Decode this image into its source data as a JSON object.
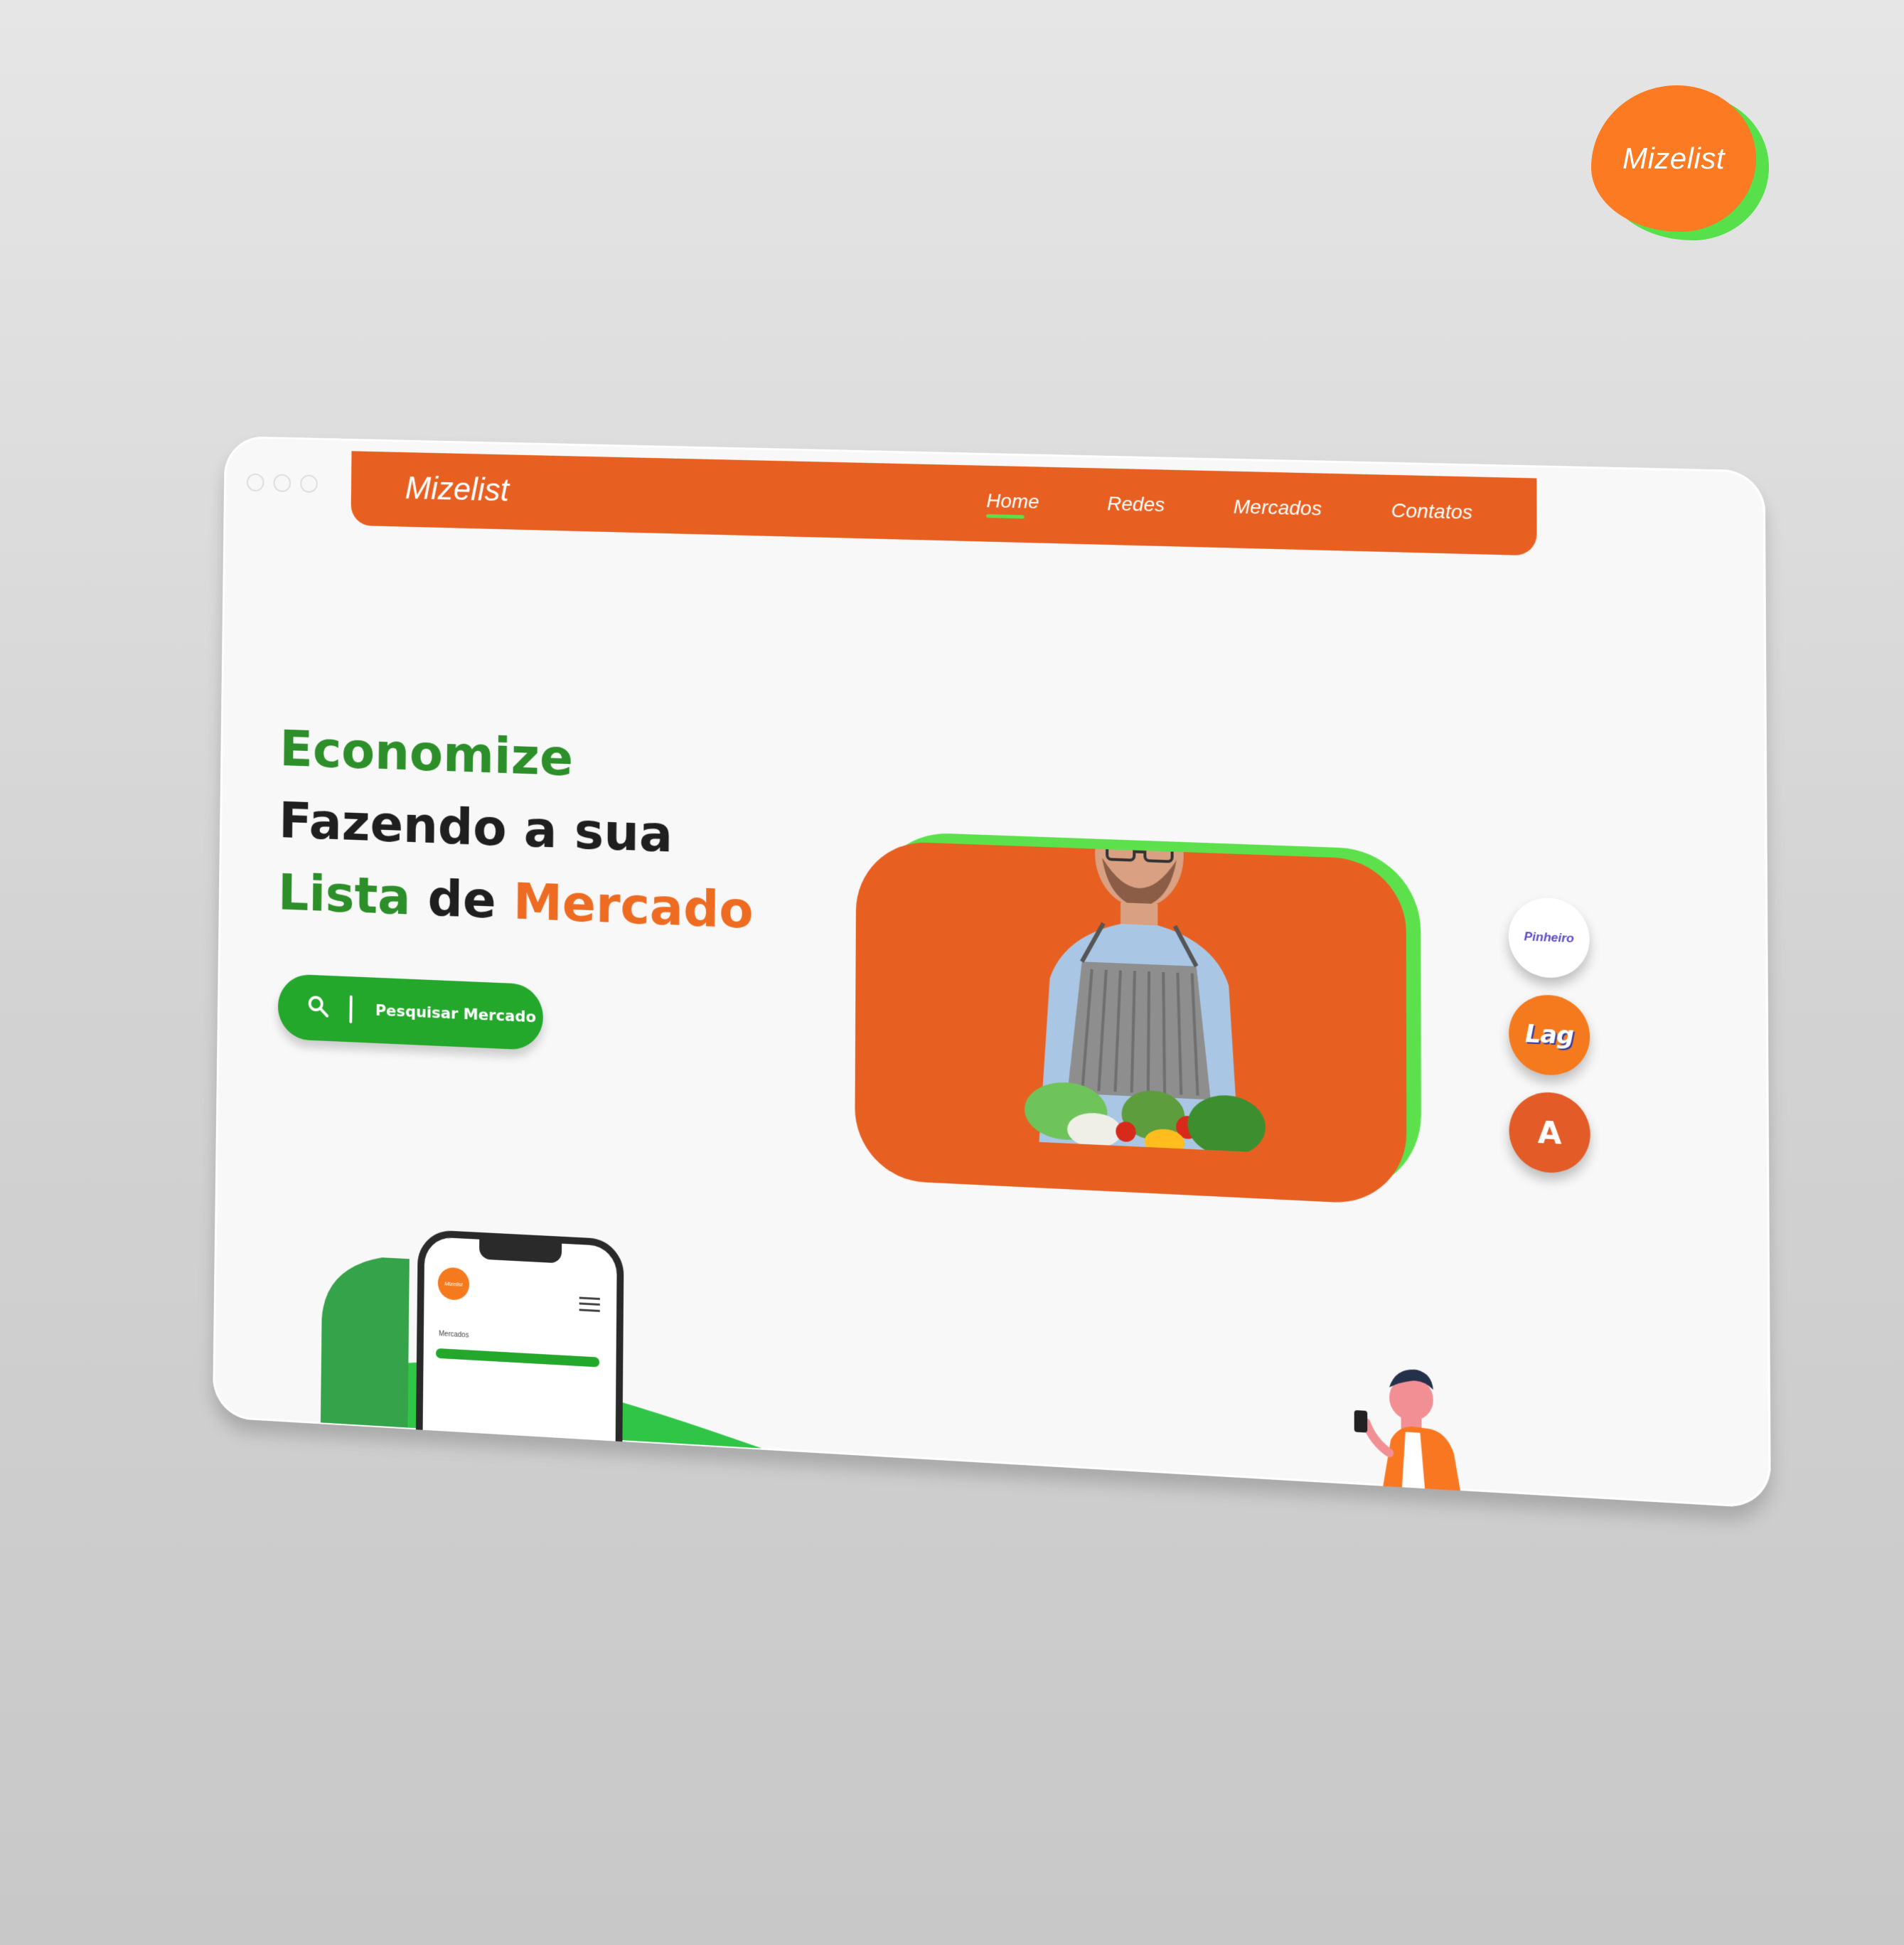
{
  "brand": {
    "badge_text": "Mizelist",
    "orange": "#FB7A22",
    "green_shadow": "#57E04A"
  },
  "window_controls": [
    {
      "name": "window-dot-1"
    },
    {
      "name": "window-dot-2"
    },
    {
      "name": "window-dot-3"
    }
  ],
  "nav": {
    "logo": "Mizelist",
    "items": [
      {
        "label": "Home",
        "active": true
      },
      {
        "label": "Redes",
        "active": false
      },
      {
        "label": "Mercados",
        "active": false
      },
      {
        "label": "Contatos",
        "active": false
      }
    ]
  },
  "hero": {
    "line1": "Economize",
    "line2": "Fazendo a sua",
    "line3_a": "Lista",
    "line3_b": " de ",
    "line3_c": "Mercado"
  },
  "search": {
    "label": "Pesquisar Mercado",
    "icon": "search-icon"
  },
  "market_logos": [
    {
      "label": "Pinheiro",
      "style": "white"
    },
    {
      "label": "Lag",
      "style": "orange"
    },
    {
      "label": "A",
      "style": "red"
    }
  ],
  "phone": {
    "logo": "Mizelist",
    "label": "Mercados"
  },
  "colors": {
    "orange_primary": "#E86021",
    "green_primary": "#23A82C",
    "green_accent": "#5CE14C",
    "text_dark": "#1F1F1F"
  }
}
